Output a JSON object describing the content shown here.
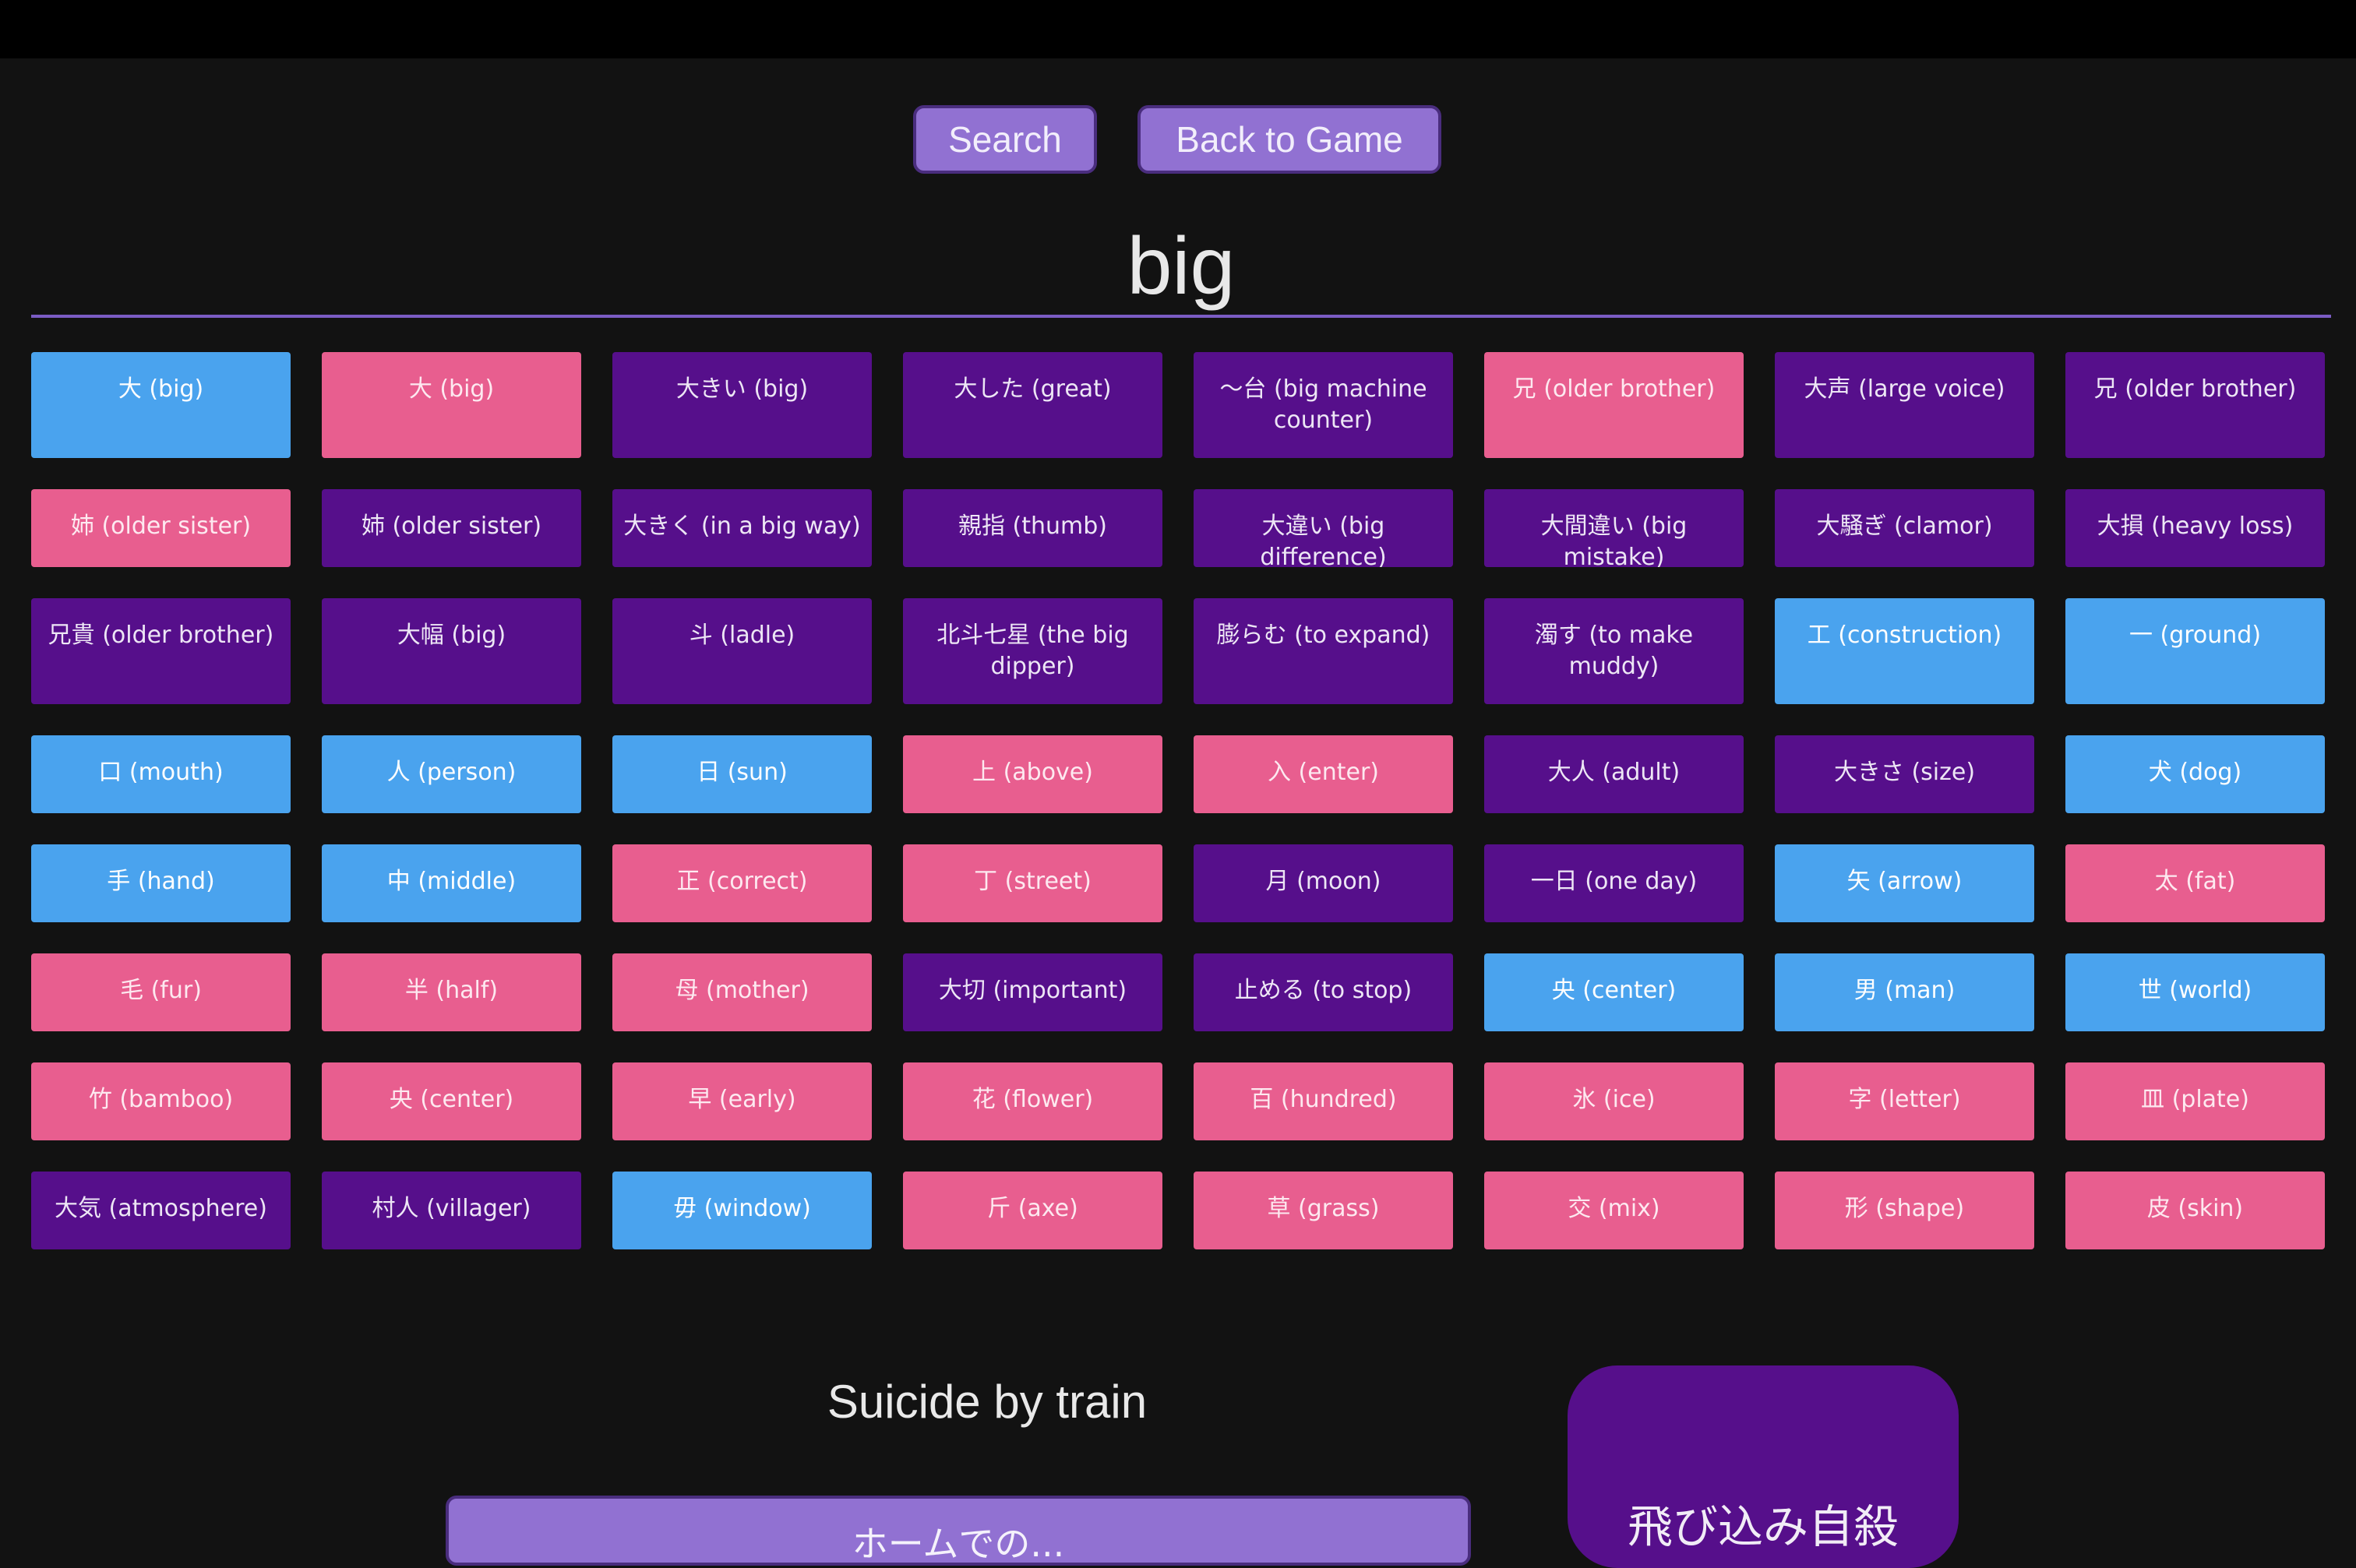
{
  "header": {
    "search_label": "Search",
    "back_label": "Back to Game"
  },
  "search": {
    "value": "big",
    "placeholder": ""
  },
  "colors": {
    "blue": "#4aa3ee",
    "pink": "#e85e8f",
    "purple": "#560f8b",
    "button": "#9171d2",
    "background": "#121212"
  },
  "results": [
    {
      "text": "大 (big)",
      "color": "blue"
    },
    {
      "text": "大 (big)",
      "color": "pink"
    },
    {
      "text": "大きい (big)",
      "color": "purple"
    },
    {
      "text": "大した (great)",
      "color": "purple"
    },
    {
      "text": "〜台 (big machine counter)",
      "color": "purple"
    },
    {
      "text": "兄 (older brother)",
      "color": "pink"
    },
    {
      "text": "大声 (large voice)",
      "color": "purple"
    },
    {
      "text": "兄 (older brother)",
      "color": "purple"
    },
    {
      "text": "姉 (older sister)",
      "color": "pink"
    },
    {
      "text": "姉 (older sister)",
      "color": "purple"
    },
    {
      "text": "大きく (in a big way)",
      "color": "purple"
    },
    {
      "text": "親指 (thumb)",
      "color": "purple"
    },
    {
      "text": "大違い (big difference)",
      "color": "purple"
    },
    {
      "text": "大間違い (big mistake)",
      "color": "purple"
    },
    {
      "text": "大騒ぎ (clamor)",
      "color": "purple"
    },
    {
      "text": "大損 (heavy loss)",
      "color": "purple"
    },
    {
      "text": "兄貴 (older brother)",
      "color": "purple"
    },
    {
      "text": "大幅 (big)",
      "color": "purple"
    },
    {
      "text": "斗 (ladle)",
      "color": "purple"
    },
    {
      "text": "北斗七星 (the big dipper)",
      "color": "purple"
    },
    {
      "text": "膨らむ (to expand)",
      "color": "purple"
    },
    {
      "text": "濁す (to make muddy)",
      "color": "purple"
    },
    {
      "text": "工 (construction)",
      "color": "blue"
    },
    {
      "text": "一 (ground)",
      "color": "blue"
    },
    {
      "text": "口 (mouth)",
      "color": "blue"
    },
    {
      "text": "人 (person)",
      "color": "blue"
    },
    {
      "text": "日 (sun)",
      "color": "blue"
    },
    {
      "text": "上 (above)",
      "color": "pink"
    },
    {
      "text": "入 (enter)",
      "color": "pink"
    },
    {
      "text": "大人 (adult)",
      "color": "purple"
    },
    {
      "text": "大きさ (size)",
      "color": "purple"
    },
    {
      "text": "犬 (dog)",
      "color": "blue"
    },
    {
      "text": "手 (hand)",
      "color": "blue"
    },
    {
      "text": "中 (middle)",
      "color": "blue"
    },
    {
      "text": "正 (correct)",
      "color": "pink"
    },
    {
      "text": "丁 (street)",
      "color": "pink"
    },
    {
      "text": "月 (moon)",
      "color": "purple"
    },
    {
      "text": "一日 (one day)",
      "color": "purple"
    },
    {
      "text": "矢 (arrow)",
      "color": "blue"
    },
    {
      "text": "太 (fat)",
      "color": "pink"
    },
    {
      "text": "毛 (fur)",
      "color": "pink"
    },
    {
      "text": "半 (half)",
      "color": "pink"
    },
    {
      "text": "母 (mother)",
      "color": "pink"
    },
    {
      "text": "大切 (important)",
      "color": "purple"
    },
    {
      "text": "止める (to stop)",
      "color": "purple"
    },
    {
      "text": "央 (center)",
      "color": "blue"
    },
    {
      "text": "男 (man)",
      "color": "blue"
    },
    {
      "text": "世 (world)",
      "color": "blue"
    },
    {
      "text": "竹 (bamboo)",
      "color": "pink"
    },
    {
      "text": "央 (center)",
      "color": "pink"
    },
    {
      "text": "早 (early)",
      "color": "pink"
    },
    {
      "text": "花 (flower)",
      "color": "pink"
    },
    {
      "text": "百 (hundred)",
      "color": "pink"
    },
    {
      "text": "氷 (ice)",
      "color": "pink"
    },
    {
      "text": "字 (letter)",
      "color": "pink"
    },
    {
      "text": "皿 (plate)",
      "color": "pink"
    },
    {
      "text": "大気 (atmosphere)",
      "color": "purple"
    },
    {
      "text": "村人 (villager)",
      "color": "purple"
    },
    {
      "text": "毋 (window)",
      "color": "blue"
    },
    {
      "text": "斤 (axe)",
      "color": "pink"
    },
    {
      "text": "草 (grass)",
      "color": "pink"
    },
    {
      "text": "交 (mix)",
      "color": "pink"
    },
    {
      "text": "形 (shape)",
      "color": "pink"
    },
    {
      "text": "皮 (skin)",
      "color": "pink"
    }
  ],
  "game": {
    "question": "Suicide by train",
    "answer_card": "飛び込み自殺",
    "choice_partial": "ホームでの..."
  }
}
